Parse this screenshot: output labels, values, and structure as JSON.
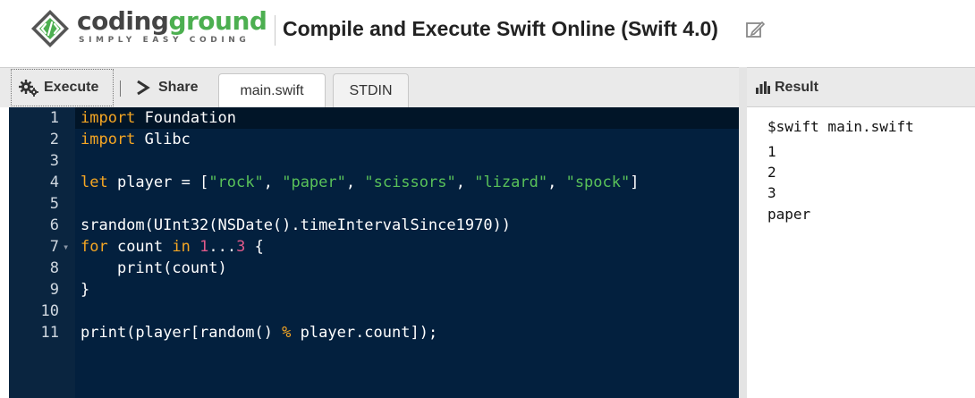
{
  "brand": {
    "name_part1": "coding",
    "name_part2": "ground",
    "tagline": "SIMPLY EASY CODING",
    "colors": {
      "dark": "#444444",
      "green": "#4caf50"
    }
  },
  "header": {
    "title": "Compile and Execute Swift Online (Swift 4.0)",
    "edit_icon": "edit-icon"
  },
  "toolbar": {
    "execute_label": "Execute",
    "execute_icon": "gears-icon",
    "share_label": "Share",
    "share_icon": "share-arrow-icon",
    "tabs": [
      {
        "label": "main.swift",
        "active": true
      },
      {
        "label": "STDIN",
        "active": false
      }
    ]
  },
  "editor": {
    "line_numbers": [
      "1",
      "2",
      "3",
      "4",
      "5",
      "6",
      "7",
      "8",
      "9",
      "10",
      "11"
    ],
    "fold_marker_line": "7",
    "tokens": {
      "kw_import": "import",
      "foundation": " Foundation",
      "glibc": " Glibc",
      "kw_let": "let",
      "player_assign": " player = [",
      "s_rock": "\"rock\"",
      "s_paper": "\"paper\"",
      "s_scissors": "\"scissors\"",
      "s_lizard": "\"lizard\"",
      "s_spock": "\"spock\"",
      "comma": ", ",
      "close_bracket": "]",
      "srandom_line": "srandom(UInt32(NSDate().timeIntervalSince1970))",
      "kw_for": "for",
      "count_sp": " count ",
      "kw_in": "in",
      "sp": " ",
      "n1": "1",
      "range_op": "...",
      "n3": "3",
      "brace_open": " {",
      "print_count": "    print(count)",
      "brace_close": "}",
      "print_player": "print(player[random() ",
      "kw_mod": "%",
      "player_count": " player.count]);"
    },
    "colors": {
      "background": "#03203e",
      "keyword": "#f5a623",
      "string": "#59c159",
      "number": "#e05a8a"
    }
  },
  "result": {
    "header_label": "Result",
    "header_icon": "bar-chart-icon",
    "output_lines": [
      "$swift main.swift",
      "1",
      "2",
      "3",
      "paper"
    ]
  }
}
